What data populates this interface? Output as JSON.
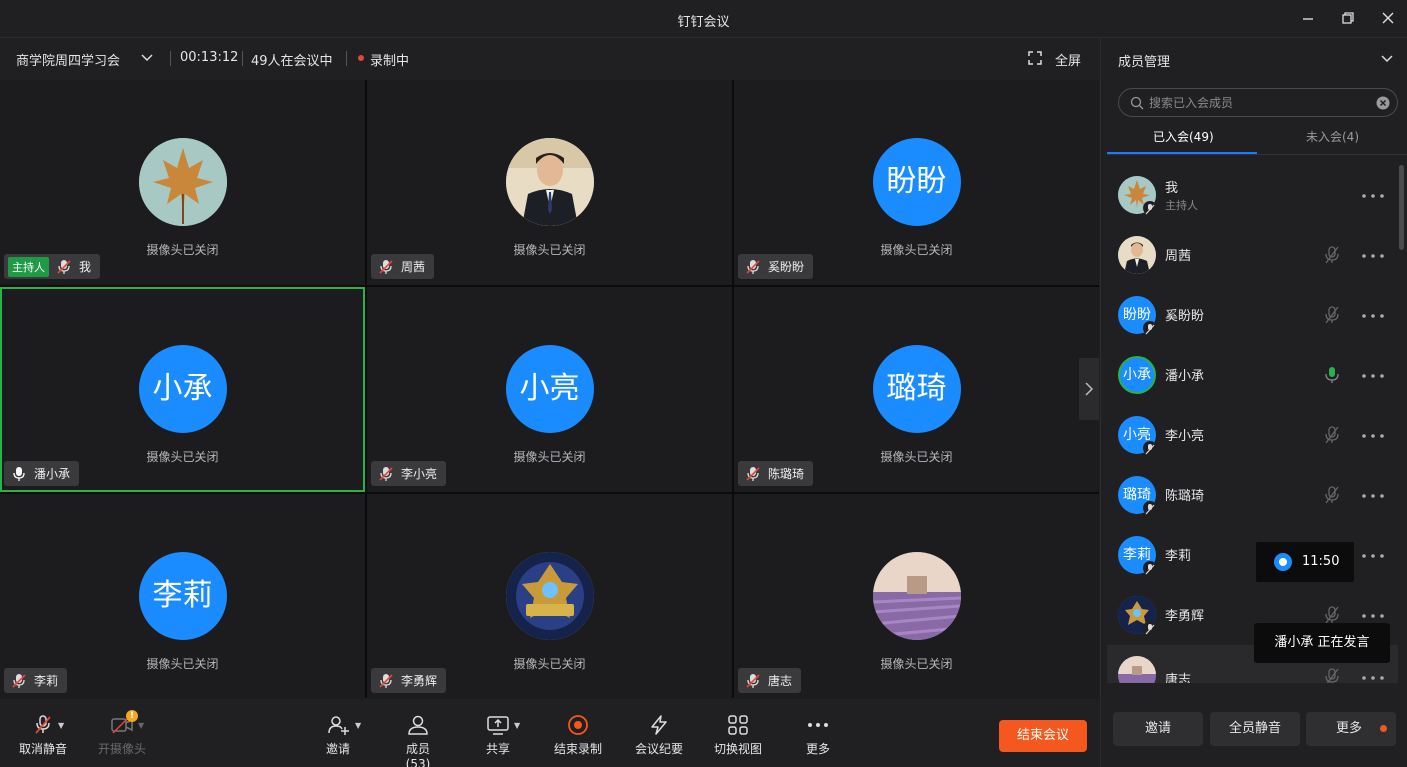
{
  "window": {
    "title": "钉钉会议"
  },
  "meeting": {
    "name": "商学院周四学习会",
    "elapsed": "00:13:12",
    "attendance": "49人在会议中",
    "recording": "录制中",
    "fullscreen_label": "全屏"
  },
  "tiles": [
    {
      "name": "我",
      "status": "摄像头已关闭",
      "host_badge": "主持人",
      "avatar_text": "",
      "avatar_image": "maple-leaf-photo",
      "mic": "muted"
    },
    {
      "name": "周茜",
      "status": "摄像头已关闭",
      "avatar_text": "",
      "avatar_image": "man-in-suit-photo",
      "mic": "muted"
    },
    {
      "name": "奚盼盼",
      "status": "摄像头已关闭",
      "avatar_text": "盼盼",
      "mic": "muted"
    },
    {
      "name": "潘小承",
      "status": "摄像头已关闭",
      "avatar_text": "小承",
      "mic": "on",
      "active_speaker": true
    },
    {
      "name": "李小亮",
      "status": "摄像头已关闭",
      "avatar_text": "小亮",
      "mic": "muted"
    },
    {
      "name": "陈璐琦",
      "status": "摄像头已关闭",
      "avatar_text": "璐琦",
      "mic": "muted"
    },
    {
      "name": "李莉",
      "status": "摄像头已关闭",
      "avatar_text": "李莉",
      "mic": "muted"
    },
    {
      "name": "李勇辉",
      "status": "摄像头已关闭",
      "avatar_text": "",
      "avatar_image": "game-emblem-photo",
      "mic": "muted"
    },
    {
      "name": "唐志",
      "status": "摄像头已关闭",
      "avatar_text": "",
      "avatar_image": "lavender-field-photo",
      "mic": "muted"
    }
  ],
  "toolbar": {
    "unmute": "取消静音",
    "camera": "开摄像头",
    "invite": "邀请",
    "members": "成员(53)",
    "share": "共享",
    "stop_recording": "结束录制",
    "minutes": "会议纪要",
    "switch_view": "切换视图",
    "more": "更多",
    "end_meeting": "结束会议"
  },
  "panel": {
    "title": "成员管理",
    "search_placeholder": "搜索已入会成员",
    "tab_joined": "已入会(49)",
    "tab_not_joined": "未入会(4)",
    "members": [
      {
        "name": "我",
        "role": "主持人",
        "avatar_text": "",
        "avatar_image": "maple-leaf-photo",
        "mic": "none"
      },
      {
        "name": "周茜",
        "avatar_text": "",
        "avatar_image": "man-in-suit-photo",
        "mic": "muted"
      },
      {
        "name": "奚盼盼",
        "avatar_text": "盼盼",
        "mic": "muted"
      },
      {
        "name": "潘小承",
        "avatar_text": "小承",
        "mic": "on"
      },
      {
        "name": "李小亮",
        "avatar_text": "小亮",
        "mic": "muted"
      },
      {
        "name": "陈璐琦",
        "avatar_text": "璐琦",
        "mic": "muted"
      },
      {
        "name": "李莉",
        "avatar_text": "李莉",
        "mic": "none"
      },
      {
        "name": "李勇辉",
        "avatar_text": "",
        "avatar_image": "game-emblem-photo",
        "mic": "muted"
      },
      {
        "name": "唐志",
        "avatar_text": "",
        "avatar_image": "lavender-field-photo",
        "mic": "muted"
      }
    ],
    "timer_popup": "11:50",
    "speaking_popup": "潘小承  正在发言",
    "btn_invite": "邀请",
    "btn_mute_all": "全员静音",
    "btn_more": "更多"
  },
  "colors": {
    "accent_blue": "#1a8cff",
    "speaker_green": "#27b34b",
    "end_orange": "#f4581e",
    "recording_red": "#e5463b",
    "muted_red": "#e5463b"
  }
}
